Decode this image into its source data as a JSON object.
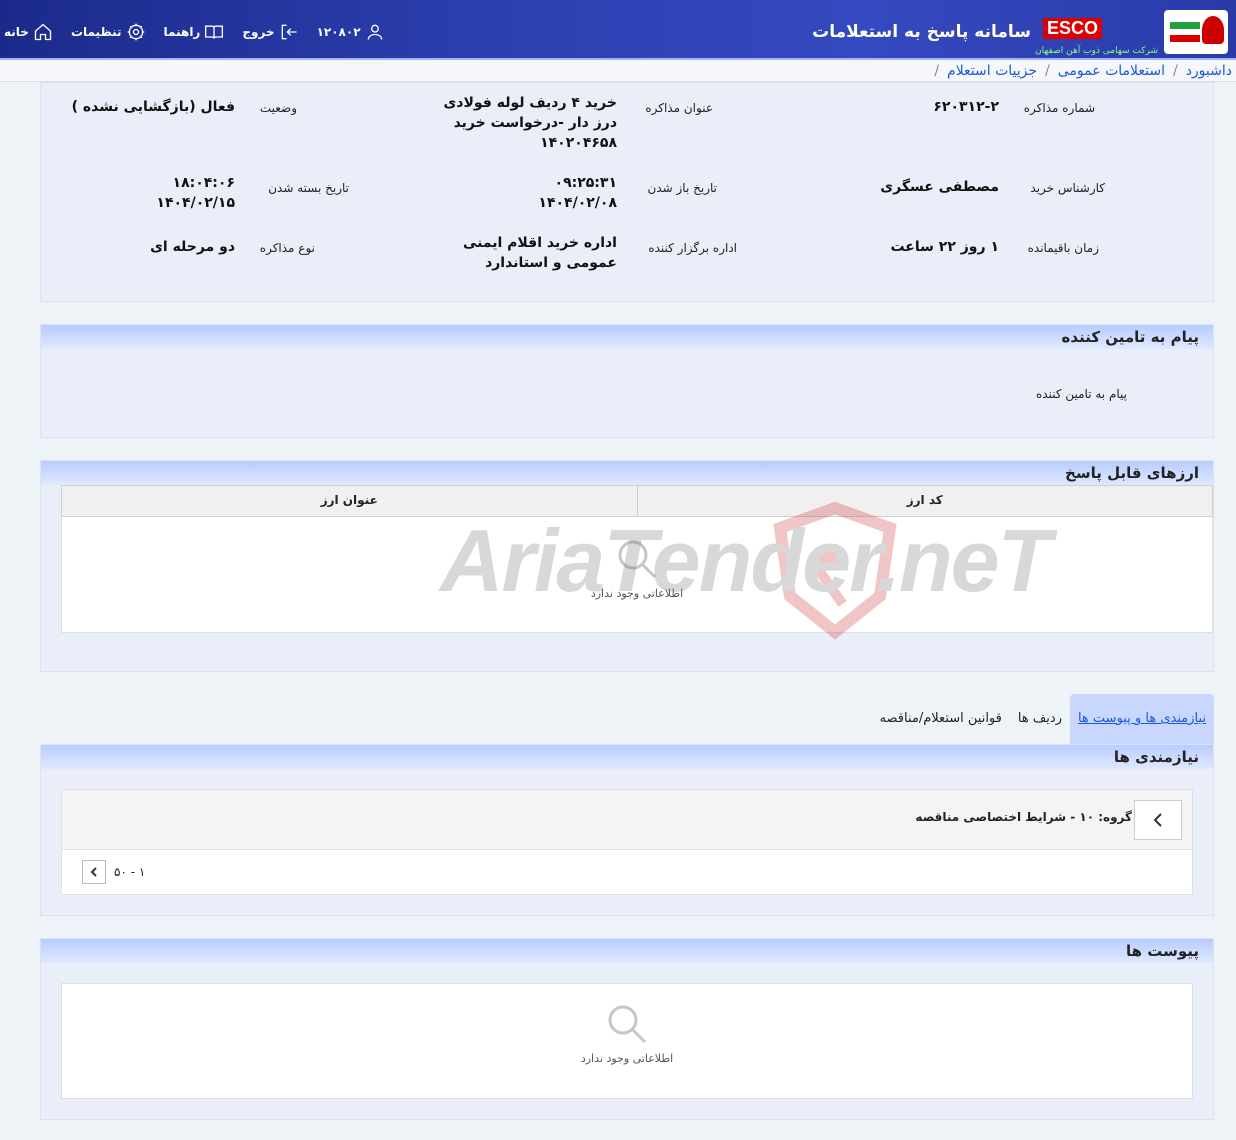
{
  "header": {
    "system_title": "سامانه پاسخ به استعلامات",
    "brand_name": "ESCO",
    "brand_subtitle": "شرکت سهامی ذوب آهن اصفهان",
    "nav": {
      "home": "خانه",
      "settings": "تنظیمات",
      "guide": "راهنما",
      "logout": "خروج",
      "user_id": "۱۲۰۸۰۲"
    }
  },
  "breadcrumb": [
    "داشبورد",
    "استعلامات عمومی",
    "جزییات استعلام"
  ],
  "details": {
    "negotiation_number_label": "شماره مذاکره",
    "negotiation_number": "۶۲۰۳۱۲-۲",
    "negotiation_title_label": "عنوان مذاکره",
    "negotiation_title_1": "خرید ۴ ردیف لوله فولادی",
    "negotiation_title_2": "درز دار -درخواست خرید",
    "negotiation_title_3": "۱۴۰۲۰۴۶۵۸",
    "status_label": "وضعیت",
    "status": "فعال (بازگشایی نشده )",
    "buyer_label": "کارشناس خرید",
    "buyer": "مصطفی عسگری",
    "open_date_label": "تاریخ باز شدن",
    "open_time": "۰۹:۲۵:۳۱",
    "open_date": "۱۴۰۴/۰۲/۰۸",
    "close_date_label": "تاریخ بسته شدن",
    "close_time": "۱۸:۰۴:۰۶",
    "close_date": "۱۴۰۴/۰۲/۱۵",
    "remaining_label": "زمان باقیمانده",
    "remaining": "۱ روز ۲۲ ساعت",
    "office_label": "اداره برگزار کننده",
    "office_1": "اداره خرید اقلام ایمنی",
    "office_2": "عمومی و استاندارد",
    "type_label": "نوع مذاکره",
    "type": "دو مرحله ای"
  },
  "supplier_message": {
    "title": "پیام به تامین کننده",
    "label": "پیام به تامین کننده"
  },
  "currencies": {
    "title": "ارزهای قابل پاسخ",
    "columns": [
      "کد ارز",
      "عنوان ارز"
    ],
    "empty_text": "اطلاعاتی وجود ندارد"
  },
  "tabs": [
    "نیازمندی ها و پیوست ها",
    "ردیف ها",
    "قوانین استعلام/مناقصه"
  ],
  "requirements": {
    "title": "نیازمندی ها",
    "group_text": "گروه: ۱۰ - شرایط اختصاصی مناقصه",
    "pager_text": "۱ - ۵۰"
  },
  "attachments": {
    "title": "پیوست ها",
    "empty_text": "اطلاعاتی وجود ندارد"
  },
  "watermark": "AriaTender.neT",
  "colors": {
    "header_bg": "#2d3fb0",
    "link": "#1d58d8",
    "panel_head": "#b8ccff"
  }
}
